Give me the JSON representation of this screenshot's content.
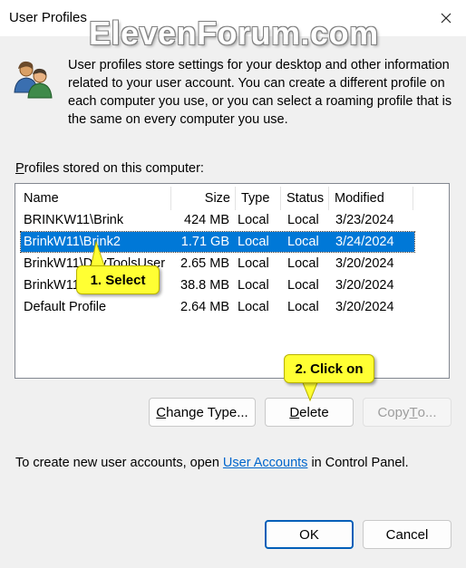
{
  "window": {
    "title": "User Profiles",
    "close_icon": "close-icon"
  },
  "watermark": "ElevenForum.com",
  "intro_text": "User profiles store settings for your desktop and other information related to your user account. You can create a different profile on each computer you use, or you can select a roaming profile that is the same on every computer you use.",
  "profiles_label": {
    "accel": "P",
    "rest": "rofiles stored on this computer:"
  },
  "columns": [
    "Name",
    "Size",
    "Type",
    "Status",
    "Modified"
  ],
  "rows": [
    {
      "name": "BRINKW11\\Brink",
      "size": "424 MB",
      "type": "Local",
      "status": "Local",
      "modified": "3/23/2024",
      "selected": false
    },
    {
      "name": "BrinkW11\\Brink2",
      "size": "1.71 GB",
      "type": "Local",
      "status": "Local",
      "modified": "3/24/2024",
      "selected": true
    },
    {
      "name": "BrinkW11\\DevToolsUser",
      "size": "2.65 MB",
      "type": "Local",
      "status": "Local",
      "modified": "3/20/2024",
      "selected": false
    },
    {
      "name": "BrinkW11\\...",
      "size": "38.8 MB",
      "type": "Local",
      "status": "Local",
      "modified": "3/20/2024",
      "selected": false
    },
    {
      "name": "Default Profile",
      "size": "2.64 MB",
      "type": "Local",
      "status": "Local",
      "modified": "3/20/2024",
      "selected": false
    }
  ],
  "buttons": {
    "change_type": {
      "accel": "C",
      "rest": "hange Type..."
    },
    "delete": {
      "accel": "D",
      "rest": "elete"
    },
    "copy_to": {
      "pre": "Copy ",
      "accel": "T",
      "rest": "o..."
    },
    "ok": "OK",
    "cancel": "Cancel"
  },
  "footer": {
    "before": "To create new user accounts, open ",
    "link": "User Accounts",
    "after": " in Control Panel."
  },
  "callouts": {
    "select": "1. Select",
    "click": "2. Click on"
  },
  "colors": {
    "selection": "#0078d7",
    "callout": "#ffff33",
    "link": "#0066cc",
    "default_button_border": "#005fb8"
  }
}
